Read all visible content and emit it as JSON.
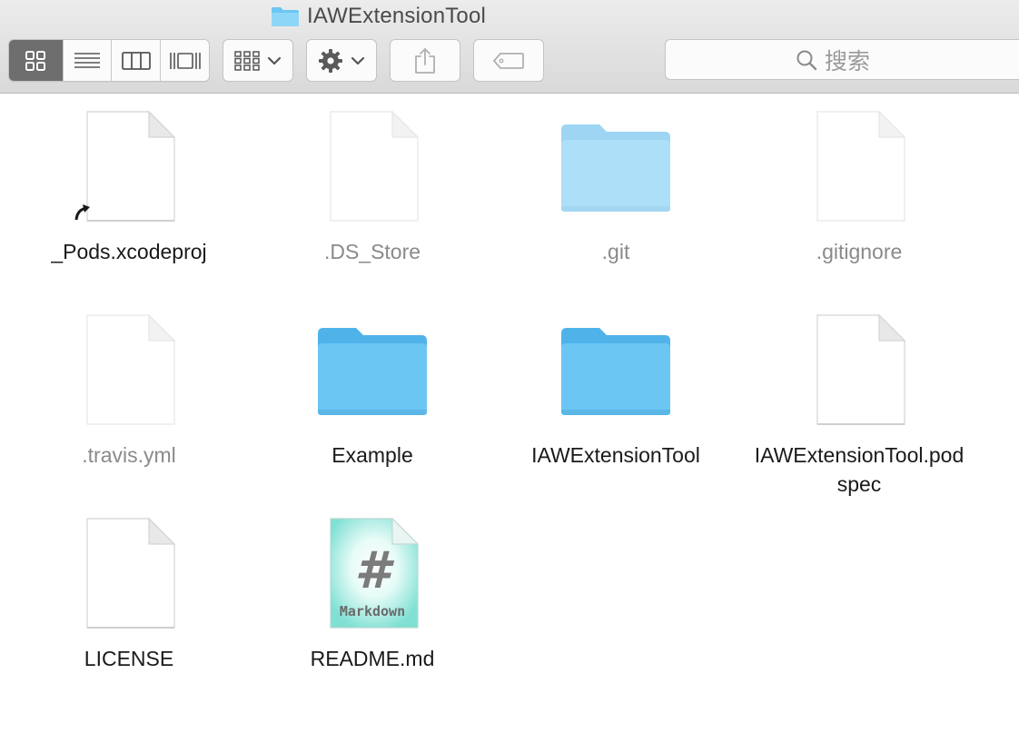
{
  "window": {
    "title": "IAWExtensionTool"
  },
  "toolbar": {
    "view_modes": [
      {
        "name": "icon-view",
        "active": true
      },
      {
        "name": "list-view",
        "active": false
      },
      {
        "name": "column-view",
        "active": false
      },
      {
        "name": "cover-flow-view",
        "active": false
      }
    ],
    "search_placeholder": "搜索"
  },
  "files": [
    {
      "label": "_Pods.xcodeproj",
      "kind": "document",
      "alias": true,
      "hidden": false
    },
    {
      "label": ".DS_Store",
      "kind": "document",
      "alias": false,
      "hidden": true
    },
    {
      "label": ".git",
      "kind": "folder",
      "alias": false,
      "hidden": true
    },
    {
      "label": ".gitignore",
      "kind": "document",
      "alias": false,
      "hidden": true
    },
    {
      "label": ".travis.yml",
      "kind": "document",
      "alias": false,
      "hidden": true
    },
    {
      "label": "Example",
      "kind": "folder",
      "alias": false,
      "hidden": false
    },
    {
      "label": "IAWExtensionTool",
      "kind": "folder",
      "alias": false,
      "hidden": false
    },
    {
      "label": "IAWExtensionTool.podspec",
      "kind": "document",
      "alias": false,
      "hidden": false
    },
    {
      "label": "LICENSE",
      "kind": "document",
      "alias": false,
      "hidden": false
    },
    {
      "label": "README.md",
      "kind": "markdown",
      "alias": false,
      "hidden": false,
      "badge": "Markdown",
      "glyph": "#"
    }
  ],
  "colors": {
    "folder": "#6cc6f3",
    "markdown": "#7fe0d3"
  }
}
